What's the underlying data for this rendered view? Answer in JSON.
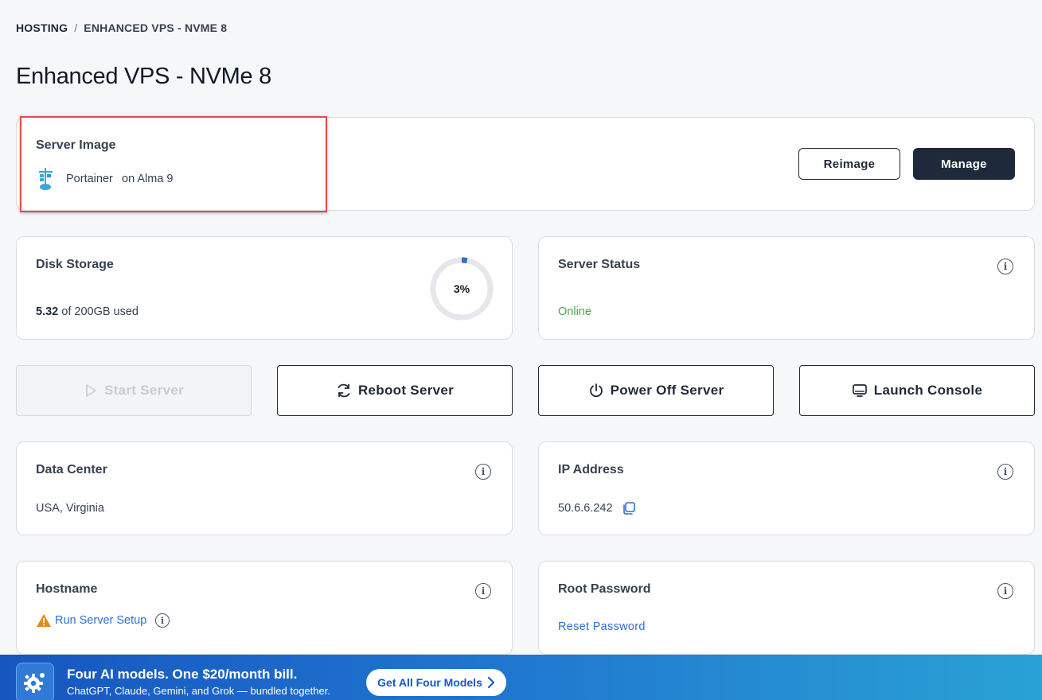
{
  "breadcrumb": {
    "items": [
      "HOSTING",
      "ENHANCED VPS - NVME 8"
    ],
    "separator": "/"
  },
  "page_title": "Enhanced VPS - NVMe 8",
  "server_image": {
    "title": "Server Image",
    "app_name": "Portainer",
    "os_text": "on Alma 9",
    "icon": "portainer-icon",
    "reimage_label": "Reimage",
    "manage_label": "Manage"
  },
  "disk_storage": {
    "title": "Disk Storage",
    "used": "5.32",
    "used_suffix": " of 200GB used",
    "percent_label": "3%",
    "percent_value": 3,
    "accent_color": "#2f6fce"
  },
  "server_status": {
    "title": "Server Status",
    "status": "Online",
    "status_color": "#4aa84a",
    "icon": "info-icon"
  },
  "actions": {
    "start": {
      "label": "Start Server",
      "icon": "play-icon",
      "disabled": true
    },
    "reboot": {
      "label": "Reboot Server",
      "icon": "refresh-icon"
    },
    "power_off": {
      "label": "Power Off Server",
      "icon": "power-icon"
    },
    "console": {
      "label": "Launch Console",
      "icon": "monitor-icon"
    }
  },
  "data_center": {
    "title": "Data Center",
    "value": "USA, Virginia"
  },
  "ip_address": {
    "title": "IP Address",
    "value": "50.6.6.242",
    "copy_icon": "copy-icon"
  },
  "hostname": {
    "title": "Hostname",
    "link": "Run Server Setup",
    "warning_icon": "warning-icon"
  },
  "root_password": {
    "title": "Root Password",
    "link": "Reset Password"
  },
  "banner": {
    "title": "Four AI models. One $20/month bill.",
    "subtitle": "ChatGPT, Claude, Gemini, and Grok — bundled together.",
    "button": "Get All Four Models",
    "icon": "gear-icon"
  }
}
